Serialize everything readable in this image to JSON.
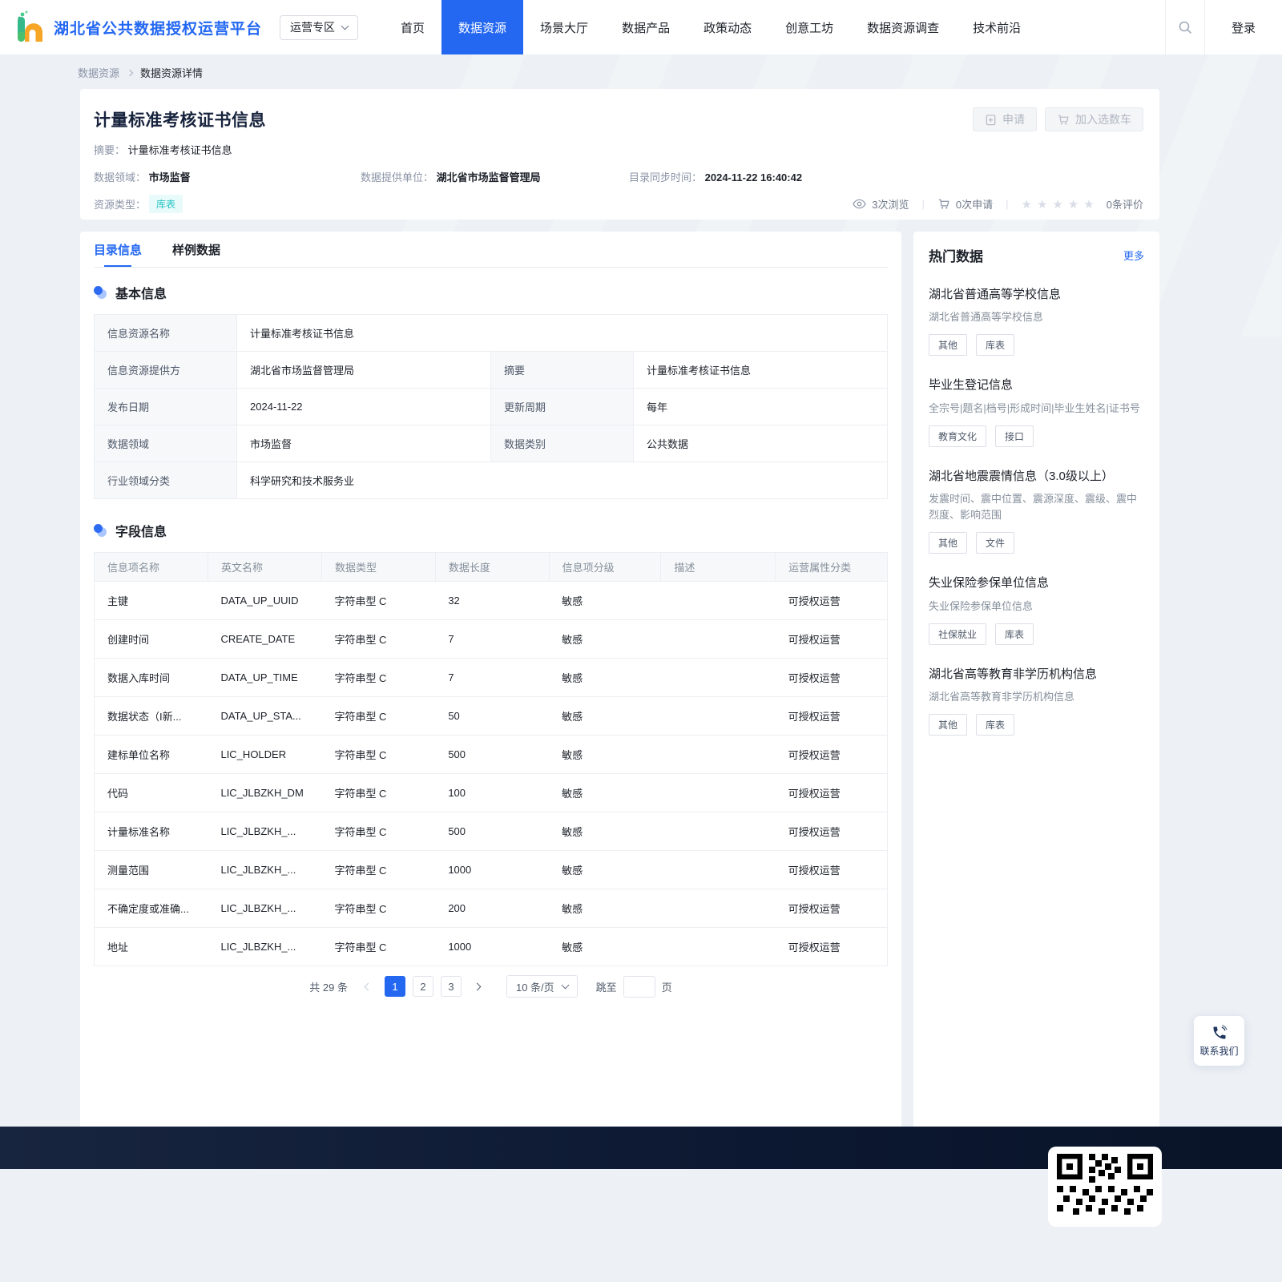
{
  "colors": {
    "primary": "#2468f2",
    "teal_tag_text": "#23c3c4",
    "teal_tag_bg": "#e8fafa",
    "footer_bg": "#0c1831"
  },
  "header": {
    "brand": "湖北省公共数据授权运营平台",
    "zone_button": "运营专区",
    "nav_items": [
      {
        "label": "首页",
        "active": false
      },
      {
        "label": "数据资源",
        "active": true
      },
      {
        "label": "场景大厅",
        "active": false
      },
      {
        "label": "数据产品",
        "active": false
      },
      {
        "label": "政策动态",
        "active": false
      },
      {
        "label": "创意工坊",
        "active": false
      },
      {
        "label": "数据资源调查",
        "active": false
      },
      {
        "label": "技术前沿",
        "active": false
      }
    ],
    "login_label": "登录"
  },
  "breadcrumb": {
    "root": "数据资源",
    "current": "数据资源详情"
  },
  "resource": {
    "title": "计量标准考核证书信息",
    "summary_label": "摘要：",
    "summary": "计量标准考核证书信息",
    "meta1_label": "数据领域：",
    "meta1": "市场监督",
    "meta2_label": "数据提供单位：",
    "meta2": "湖北省市场监督管理局",
    "meta3_label": "目录同步时间：",
    "meta3": "2024-11-22 16:40:42",
    "type_label": "资源类型：",
    "type_tag": "库表",
    "apply_button": "申请",
    "cart_button": "加入选数车",
    "views": "3次浏览",
    "applies": "0次申请",
    "reviews": "0条评价",
    "stars": "★★★★★"
  },
  "tabs": {
    "catalog": "目录信息",
    "sample": "样例数据"
  },
  "basic": {
    "section_title": "基本信息",
    "r1_label": "信息资源名称",
    "r1_value": "计量标准考核证书信息",
    "r2a_label": "信息资源提供方",
    "r2a_value": "湖北省市场监督管理局",
    "r2b_label": "摘要",
    "r2b_value": "计量标准考核证书信息",
    "r3a_label": "发布日期",
    "r3a_value": "2024-11-22",
    "r3b_label": "更新周期",
    "r3b_value": "每年",
    "r4a_label": "数据领域",
    "r4a_value": "市场监督",
    "r4b_label": "数据类别",
    "r4b_value": "公共数据",
    "r5_label": "行业领域分类",
    "r5_value": "科学研究和技术服务业"
  },
  "fields": {
    "section_title": "字段信息",
    "columns": [
      "信息项名称",
      "英文名称",
      "数据类型",
      "数据长度",
      "信息项分级",
      "描述",
      "运营属性分类"
    ],
    "rows": [
      {
        "name": "主键",
        "en": "DATA_UP_UUID",
        "type": "字符串型 C",
        "len": "32",
        "level": "敏感",
        "desc": "",
        "ops": "可授权运营"
      },
      {
        "name": "创建时间",
        "en": "CREATE_DATE",
        "type": "字符串型 C",
        "len": "7",
        "level": "敏感",
        "desc": "",
        "ops": "可授权运营"
      },
      {
        "name": "数据入库时间",
        "en": "DATA_UP_TIME",
        "type": "字符串型 C",
        "len": "7",
        "level": "敏感",
        "desc": "",
        "ops": "可授权运营"
      },
      {
        "name": "数据状态（I新...",
        "en": "DATA_UP_STA...",
        "type": "字符串型 C",
        "len": "50",
        "level": "敏感",
        "desc": "",
        "ops": "可授权运营"
      },
      {
        "name": "建标单位名称",
        "en": "LIC_HOLDER",
        "type": "字符串型 C",
        "len": "500",
        "level": "敏感",
        "desc": "",
        "ops": "可授权运营"
      },
      {
        "name": "代码",
        "en": "LIC_JLBZKH_DM",
        "type": "字符串型 C",
        "len": "100",
        "level": "敏感",
        "desc": "",
        "ops": "可授权运营"
      },
      {
        "name": "计量标准名称",
        "en": "LIC_JLBZKH_...",
        "type": "字符串型 C",
        "len": "500",
        "level": "敏感",
        "desc": "",
        "ops": "可授权运营"
      },
      {
        "name": "测量范围",
        "en": "LIC_JLBZKH_...",
        "type": "字符串型 C",
        "len": "1000",
        "level": "敏感",
        "desc": "",
        "ops": "可授权运营"
      },
      {
        "name": "不确定度或准确...",
        "en": "LIC_JLBZKH_...",
        "type": "字符串型 C",
        "len": "200",
        "level": "敏感",
        "desc": "",
        "ops": "可授权运营"
      },
      {
        "name": "地址",
        "en": "LIC_JLBZKH_...",
        "type": "字符串型 C",
        "len": "1000",
        "level": "敏感",
        "desc": "",
        "ops": "可授权运营"
      }
    ]
  },
  "pagination": {
    "total": "共 29 条",
    "page1": "1",
    "page2": "2",
    "page3": "3",
    "page_size": "10 条/页",
    "jump_label": "跳至",
    "jump_unit": "页"
  },
  "hot": {
    "title": "热门数据",
    "more": "更多",
    "items": [
      {
        "title": "湖北省普通高等学校信息",
        "desc": "湖北省普通高等学校信息",
        "tag1": "其他",
        "tag2": "库表"
      },
      {
        "title": "毕业生登记信息",
        "desc": "全宗号|题名|档号|形成时间|毕业生姓名|证书号",
        "tag1": "教育文化",
        "tag2": "接口"
      },
      {
        "title": "湖北省地震震情信息（3.0级以上）",
        "desc": "发震时间、震中位置、震源深度、震级、震中烈度、影响范围",
        "tag1": "其他",
        "tag2": "文件"
      },
      {
        "title": "失业保险参保单位信息",
        "desc": "失业保险参保单位信息",
        "tag1": "社保就业",
        "tag2": "库表"
      },
      {
        "title": "湖北省高等教育非学历机构信息",
        "desc": "湖北省高等教育非学历机构信息",
        "tag1": "其他",
        "tag2": "库表"
      }
    ]
  },
  "contact": {
    "label": "联系我们"
  }
}
